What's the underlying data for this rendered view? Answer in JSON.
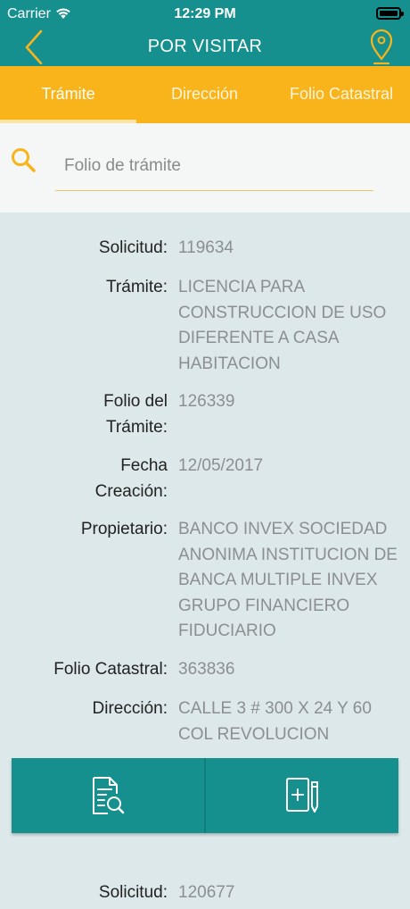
{
  "status": {
    "carrier": "Carrier",
    "time": "12:29 PM"
  },
  "nav": {
    "title": "POR VISITAR",
    "back_icon": "chevron-left-icon",
    "map_icon": "map-pin-icon"
  },
  "tabs": [
    {
      "label": "Trámite",
      "active": true
    },
    {
      "label": "Dirección",
      "active": false
    },
    {
      "label": "Folio Catastral",
      "active": false
    }
  ],
  "search": {
    "placeholder": "Folio de trámite",
    "value": ""
  },
  "record": {
    "solicitud": {
      "label": "Solicitud:",
      "value": "119634"
    },
    "tramite": {
      "label": "Trámite:",
      "value": "LICENCIA PARA CONSTRUCCION DE USO DIFERENTE A CASA HABITACION"
    },
    "folio_tramite": {
      "label": "Folio del Trámite:",
      "value": "126339"
    },
    "fecha": {
      "label": "Fecha Creación:",
      "value": "12/05/2017"
    },
    "propietario": {
      "label": "Propietario:",
      "value": "BANCO INVEX SOCIEDAD ANONIMA INSTITUCION DE BANCA MULTIPLE INVEX GRUPO FINANCIERO FIDUCIARIO"
    },
    "folio_catastral": {
      "label": "Folio Catastral:",
      "value": "363836"
    },
    "direccion": {
      "label": "Dirección:",
      "value": "CALLE 3 # 300 X 24 Y 60 COL REVOLUCION"
    }
  },
  "actions": {
    "view_icon": "document-search-icon",
    "add_icon": "add-document-icon"
  },
  "next_record": {
    "solicitud": {
      "label": "Solicitud:",
      "value": "120677"
    }
  },
  "colors": {
    "teal": "#15908f",
    "amber": "#f8b41a",
    "background": "#dde8ea"
  }
}
